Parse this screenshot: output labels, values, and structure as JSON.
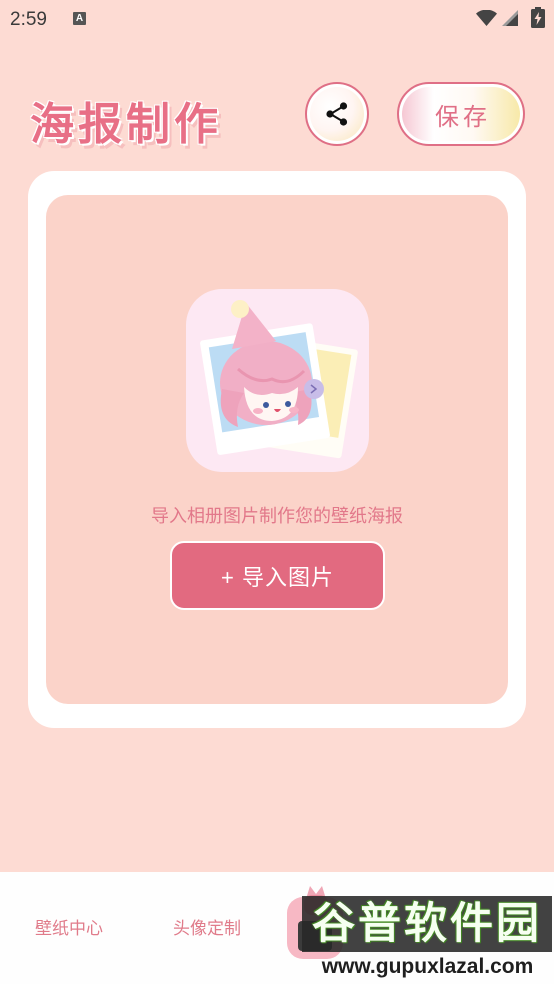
{
  "status_bar": {
    "time": "2:59",
    "notification_glyph": "A",
    "icons": [
      "a-notification-icon",
      "wifi-icon",
      "signal-icon",
      "battery-charging-icon"
    ]
  },
  "header": {
    "title": "海报制作",
    "share_icon": "share-icon",
    "save_label": "保存"
  },
  "editor": {
    "placeholder_image": "polaroid-photo-girl-illustration",
    "hint": "导入相册图片制作您的壁纸海报",
    "import_label": "+ 导入图片"
  },
  "bottom_nav": {
    "items": [
      {
        "label": "壁纸中心"
      },
      {
        "label": "头像定制"
      }
    ],
    "center_icon": "cat-phone-icon"
  },
  "watermark": {
    "name": "谷普软件园",
    "url": "www.gupuxlazal.com"
  },
  "colors": {
    "background": "#fddbd3",
    "panel": "#fbd3c9",
    "card": "#ffffff",
    "accent": "#e26a80",
    "accent_text": "#e2788a",
    "nav_background": "#fefefe"
  }
}
